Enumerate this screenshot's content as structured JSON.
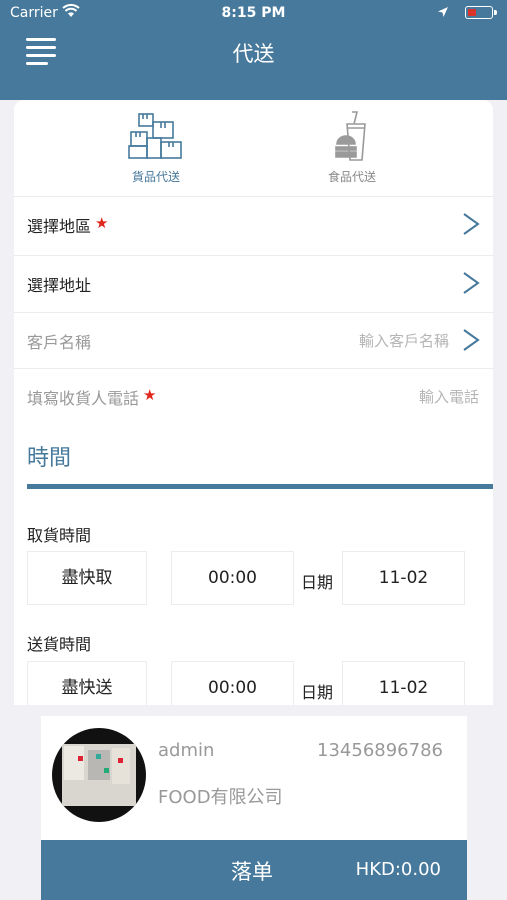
{
  "status_bar": {
    "carrier": "Carrier",
    "time": "8:15 PM"
  },
  "header": {
    "title": "代送"
  },
  "tabs": [
    {
      "label": "貨品代送",
      "icon": "boxes-icon",
      "active": true
    },
    {
      "label": "食品代送",
      "icon": "burger-drink-icon",
      "active": false
    }
  ],
  "form": {
    "region": {
      "label": "選擇地區"
    },
    "address": {
      "label": "選擇地址"
    },
    "customer": {
      "label": "客戶名稱",
      "placeholder": "輸入客戶名稱"
    },
    "phone": {
      "label": "填寫收貨人電話",
      "placeholder": "輸入電話"
    }
  },
  "time_section": {
    "title": "時間",
    "pickup": {
      "label": "取貨時間",
      "mode": "盡快取",
      "time": "00:00",
      "date_label": "日期",
      "date": "11-02"
    },
    "delivery": {
      "label": "送貨時間",
      "mode": "盡快送",
      "time": "00:00",
      "date_label": "日期",
      "date": "11-02"
    }
  },
  "account": {
    "name": "admin",
    "phone": "13456896786",
    "company": "FOOD有限公司"
  },
  "footer": {
    "submit_label": "落单",
    "total": "HKD:0.00"
  },
  "colors": {
    "primary": "#46799c",
    "required_star": "#e0261b"
  }
}
